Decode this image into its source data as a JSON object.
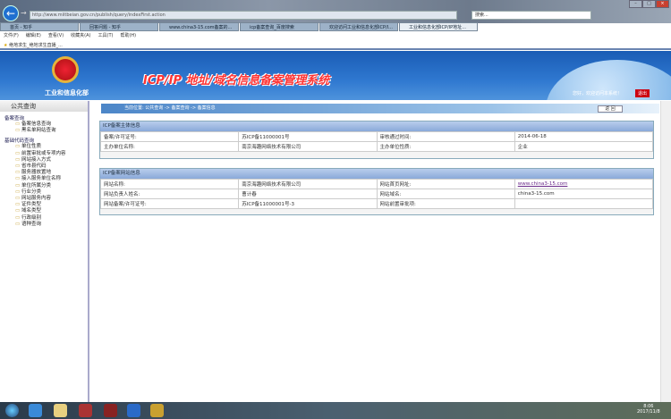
{
  "browser": {
    "address": "http://www.miitbeian.gov.cn/publish/query/indexFirst.action",
    "search_placeholder": "搜索...",
    "tabs": [
      "首页 - 知乎",
      "回答问题 - 知乎",
      "www.china3-15.com备案的...",
      "icp备案查询_百度搜索",
      "欢迎访问工业和信息化部ICP/I...",
      "工业和信息化部ICP/IP地址..."
    ],
    "menu": [
      "文件(F)",
      "编辑(E)",
      "查看(V)",
      "收藏夹(A)",
      "工具(T)",
      "帮助(H)"
    ],
    "favorite": "绝地求生_绝地求生直播_..."
  },
  "banner": {
    "title": "ICP/IP 地址/域名信息备案管理系统",
    "ministry": "工业和信息化部",
    "welcome": "您好，欢迎访问本系统！",
    "logout": "退出"
  },
  "sidebar": {
    "title": "公共查询",
    "groups": [
      {
        "label": "备案查询",
        "items": [
          "备案信息查询",
          "黑名单网站查询"
        ]
      },
      {
        "label": "基础代码查询",
        "items": [
          "单位性质",
          "前置审批或专项内容",
          "网站接入方式",
          "省市县代码",
          "服务器放置地",
          "接入服务单位名称",
          "单位所属分类",
          "行业分类",
          "网站服务内容",
          "证件类型",
          "域名类型",
          "行政级别",
          "语种查询"
        ]
      }
    ]
  },
  "breadcrumb": "当前位置: 公共查询 -> 备案查询 -> 备案信息",
  "back_button": "返 回",
  "subject": {
    "title": "ICP备案主体信息",
    "rows": [
      [
        "备案/许可证号:",
        "苏ICP备11000001号",
        "审核通过时间:",
        "2014-06-18"
      ],
      [
        "主办单位名称:",
        "南京海趣网络技术有限公司",
        "主办单位性质:",
        "企业"
      ]
    ]
  },
  "website": {
    "title": "ICP备案网站信息",
    "rows": [
      [
        "网站名称:",
        "南京海趣网络技术有限公司",
        "网站首页网址:",
        "www.china3-15.com"
      ],
      [
        "网站负责人姓名:",
        "曹计春",
        "网站域名:",
        "china3-15.com"
      ],
      [
        "网站备案/许可证号:",
        "苏ICP备11000001号-3",
        "网站前置审批项:",
        ""
      ]
    ]
  },
  "taskbar": {
    "time": "8:06",
    "date": "2017/11/8"
  }
}
